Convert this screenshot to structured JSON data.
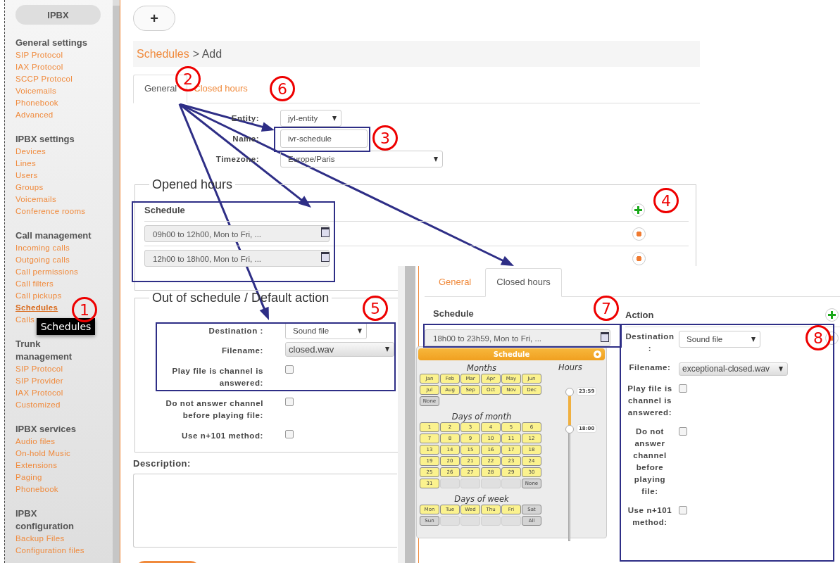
{
  "sidebar": {
    "title": "IPBX",
    "sections": [
      {
        "heading": "General settings",
        "items": [
          {
            "label": "SIP Protocol",
            "selected": false
          },
          {
            "label": "IAX Protocol",
            "selected": false
          },
          {
            "label": "SCCP Protocol",
            "selected": false
          },
          {
            "label": "Voicemails",
            "selected": false
          },
          {
            "label": "Phonebook",
            "selected": false
          },
          {
            "label": "Advanced",
            "selected": false
          }
        ]
      },
      {
        "heading": "IPBX settings",
        "items": [
          {
            "label": "Devices",
            "selected": false
          },
          {
            "label": "Lines",
            "selected": false
          },
          {
            "label": "Users",
            "selected": false
          },
          {
            "label": "Groups",
            "selected": false
          },
          {
            "label": "Voicemails",
            "selected": false
          },
          {
            "label": "Conference rooms",
            "selected": false
          }
        ]
      },
      {
        "heading": "Call management",
        "items": [
          {
            "label": "Incoming calls",
            "selected": false
          },
          {
            "label": "Outgoing calls",
            "selected": false
          },
          {
            "label": "Call permissions",
            "selected": false
          },
          {
            "label": "Call filters",
            "selected": false
          },
          {
            "label": "Call pickups",
            "selected": false
          },
          {
            "label": "Schedules",
            "selected": true
          },
          {
            "label": "Calls",
            "selected": false
          }
        ]
      },
      {
        "heading": "Trunk management",
        "items": [
          {
            "label": "SIP Protocol",
            "selected": false
          },
          {
            "label": "SIP Provider",
            "selected": false
          },
          {
            "label": "IAX Protocol",
            "selected": false
          },
          {
            "label": "Customized",
            "selected": false
          }
        ]
      },
      {
        "heading": "IPBX services",
        "items": [
          {
            "label": "Audio files",
            "selected": false
          },
          {
            "label": "On-hold Music",
            "selected": false
          },
          {
            "label": "Extensions",
            "selected": false
          },
          {
            "label": "Paging",
            "selected": false
          },
          {
            "label": "Phonebook",
            "selected": false
          }
        ]
      },
      {
        "heading": "IPBX configuration",
        "items": [
          {
            "label": "Backup Files",
            "selected": false
          },
          {
            "label": "Configuration files",
            "selected": false
          }
        ]
      }
    ]
  },
  "tooltip": "Schedules",
  "add_button": "+",
  "breadcrumb": {
    "link": "Schedules",
    "current": "> Add"
  },
  "tabs": [
    {
      "label": "General",
      "selected": true
    },
    {
      "label": "Closed hours",
      "selected": false
    }
  ],
  "general_fields": [
    {
      "kind": "select",
      "label": "Entity:",
      "value": "jyl-entity"
    },
    {
      "kind": "text",
      "label": "Name:",
      "value": "ivr-schedule"
    },
    {
      "kind": "select",
      "label": "Timezone:",
      "value": "Europe/Paris"
    }
  ],
  "opened_hours": {
    "title": "Opened hours",
    "column": "Schedule",
    "rows": [
      "09h00 to 12h00, Mon to Fri, ...",
      "12h00 to 18h00, Mon to Fri, ..."
    ]
  },
  "default_action": {
    "title": "Out of schedule / Default action",
    "fields": [
      {
        "kind": "select",
        "label": "Destination :",
        "value": "Sound file"
      },
      {
        "kind": "select",
        "label": "Filename:",
        "value": "closed.wav"
      },
      {
        "kind": "checkbox",
        "label": "Play file is channel is answered:",
        "checked": false
      },
      {
        "kind": "checkbox",
        "label": "Do not answer channel before playing file:",
        "checked": false
      },
      {
        "kind": "checkbox",
        "label": "Use n+101 method:",
        "checked": false
      }
    ]
  },
  "description": {
    "label": "Description:"
  },
  "inset": {
    "tabs": [
      {
        "label": "General",
        "selected": false
      },
      {
        "label": "Closed hours",
        "selected": true
      }
    ],
    "schedule_column": "Schedule",
    "action_column": "Action",
    "schedule": "18h00 to 23h59, Mon to Fri, ...",
    "action_fields": [
      {
        "kind": "select",
        "label": "Destination :",
        "value": "Sound file"
      },
      {
        "kind": "select",
        "label": "Filename:",
        "value": "exceptional-closed.wav"
      },
      {
        "kind": "checkbox",
        "label": "Play file is channel is answered:",
        "checked": false
      },
      {
        "kind": "checkbox",
        "label": "Do not answer channel before playing file:",
        "checked": false
      },
      {
        "kind": "checkbox",
        "label": "Use n+101 method:",
        "checked": false
      }
    ],
    "picker": {
      "title": "Schedule",
      "months_title": "Months",
      "months": [
        {
          "label": "Jan",
          "selected": true
        },
        {
          "label": "Feb",
          "selected": true
        },
        {
          "label": "Mar",
          "selected": true
        },
        {
          "label": "Apr",
          "selected": true
        },
        {
          "label": "May",
          "selected": true
        },
        {
          "label": "Jun",
          "selected": true
        },
        {
          "label": "Jul",
          "selected": true
        },
        {
          "label": "Aug",
          "selected": true
        },
        {
          "label": "Sep",
          "selected": true
        },
        {
          "label": "Oct",
          "selected": true
        },
        {
          "label": "Nov",
          "selected": true
        },
        {
          "label": "Dec",
          "selected": true
        }
      ],
      "months_none": "None",
      "days_title": "Days of month",
      "days": [
        {
          "label": "1",
          "selected": true
        },
        {
          "label": "2",
          "selected": true
        },
        {
          "label": "3",
          "selected": true
        },
        {
          "label": "4",
          "selected": true
        },
        {
          "label": "5",
          "selected": true
        },
        {
          "label": "6",
          "selected": true
        },
        {
          "label": "7",
          "selected": true
        },
        {
          "label": "8",
          "selected": true
        },
        {
          "label": "9",
          "selected": true
        },
        {
          "label": "10",
          "selected": true
        },
        {
          "label": "11",
          "selected": true
        },
        {
          "label": "12",
          "selected": true
        },
        {
          "label": "13",
          "selected": true
        },
        {
          "label": "14",
          "selected": true
        },
        {
          "label": "15",
          "selected": true
        },
        {
          "label": "16",
          "selected": true
        },
        {
          "label": "17",
          "selected": true
        },
        {
          "label": "18",
          "selected": true
        },
        {
          "label": "19",
          "selected": true
        },
        {
          "label": "20",
          "selected": true
        },
        {
          "label": "21",
          "selected": true
        },
        {
          "label": "22",
          "selected": true
        },
        {
          "label": "23",
          "selected": true
        },
        {
          "label": "24",
          "selected": true
        },
        {
          "label": "25",
          "selected": true
        },
        {
          "label": "26",
          "selected": true
        },
        {
          "label": "27",
          "selected": true
        },
        {
          "label": "28",
          "selected": true
        },
        {
          "label": "29",
          "selected": true
        },
        {
          "label": "30",
          "selected": true
        },
        {
          "label": "31",
          "selected": true
        }
      ],
      "days_none": "None",
      "weekdays_title": "Days of week",
      "weekdays": [
        {
          "label": "Mon",
          "selected": true
        },
        {
          "label": "Tue",
          "selected": true
        },
        {
          "label": "Wed",
          "selected": true
        },
        {
          "label": "Thu",
          "selected": true
        },
        {
          "label": "Fri",
          "selected": true
        },
        {
          "label": "Sat",
          "selected": false
        },
        {
          "label": "Sun",
          "selected": false
        }
      ],
      "weekdays_all": "All",
      "hours_title": "Hours",
      "handles": [
        {
          "label": "23:59",
          "level": 1
        },
        {
          "label": "18:00",
          "level": 0.75
        }
      ]
    }
  },
  "annotations": [
    "1",
    "2",
    "3",
    "4",
    "5",
    "6",
    "7",
    "8"
  ]
}
